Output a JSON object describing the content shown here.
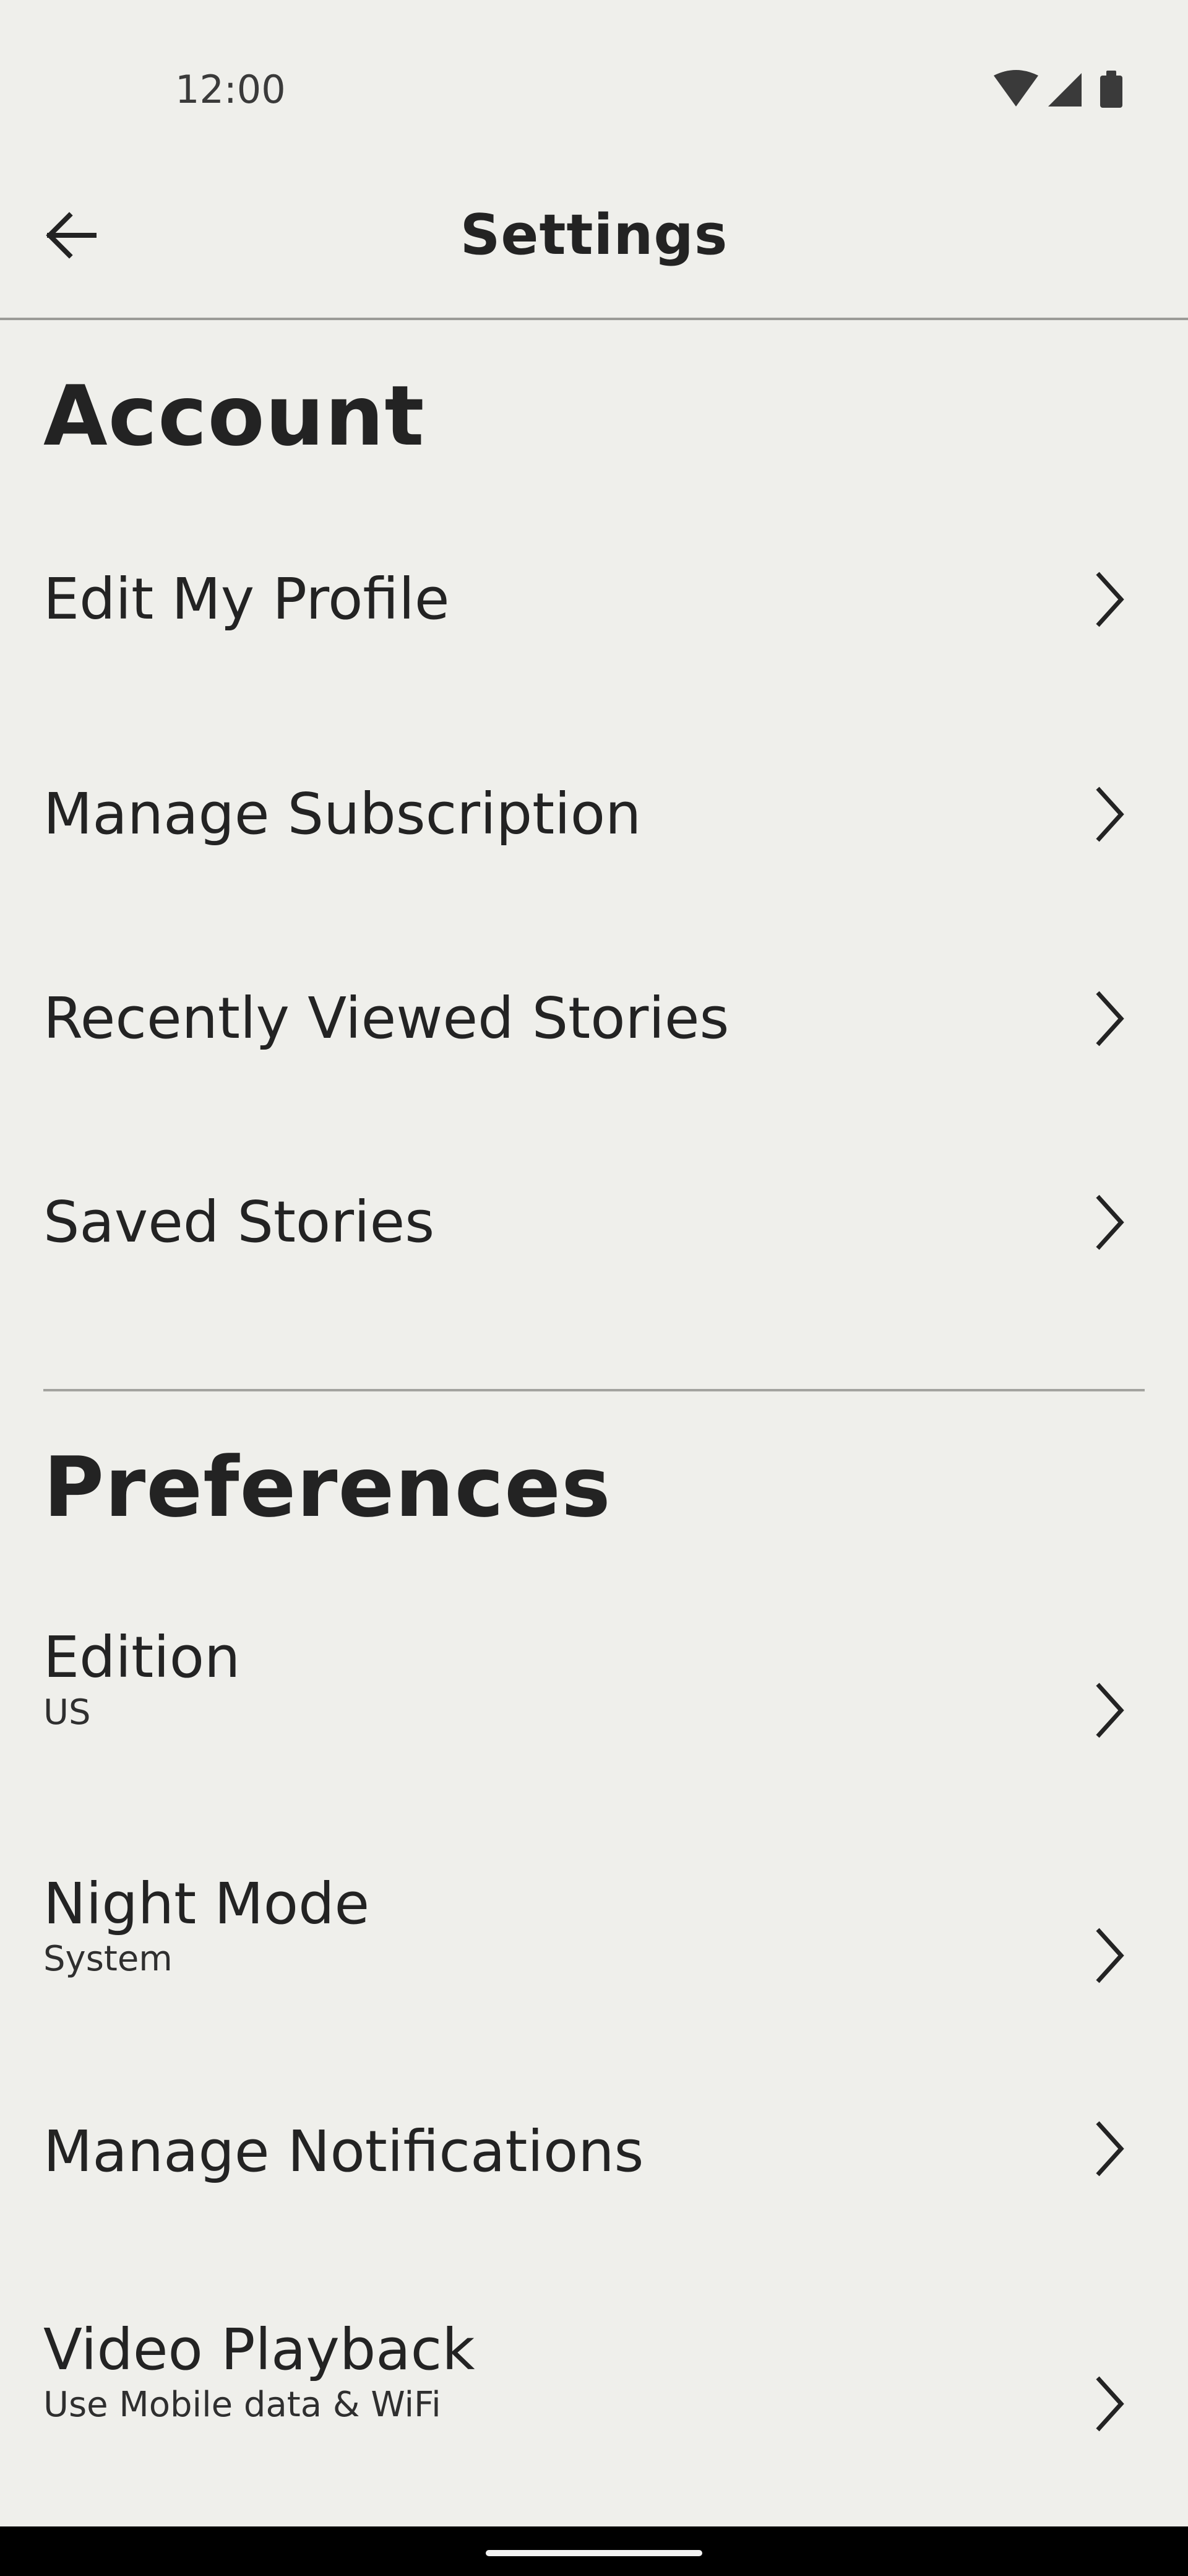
{
  "status_bar": {
    "time": "12:00",
    "icons": [
      "wifi-icon",
      "cellular-signal-icon",
      "battery-icon"
    ]
  },
  "app_bar": {
    "back_icon": "arrow-left-icon",
    "title": "Settings"
  },
  "sections": {
    "account": {
      "title": "Account",
      "items": [
        {
          "label": "Edit My Profile"
        },
        {
          "label": "Manage Subscription"
        },
        {
          "label": "Recently Viewed Stories"
        },
        {
          "label": "Saved Stories"
        }
      ]
    },
    "preferences": {
      "title": "Preferences",
      "items": [
        {
          "label": "Edition",
          "sublabel": "US"
        },
        {
          "label": "Night Mode",
          "sublabel": "System"
        },
        {
          "label": "Manage Notifications"
        },
        {
          "label": "Video Playback",
          "sublabel": "Use Mobile data & WiFi"
        }
      ]
    }
  },
  "colors": {
    "background": "#efefeb",
    "text": "#232323",
    "divider": "#9b9b97",
    "nav_bar": "#000000"
  }
}
